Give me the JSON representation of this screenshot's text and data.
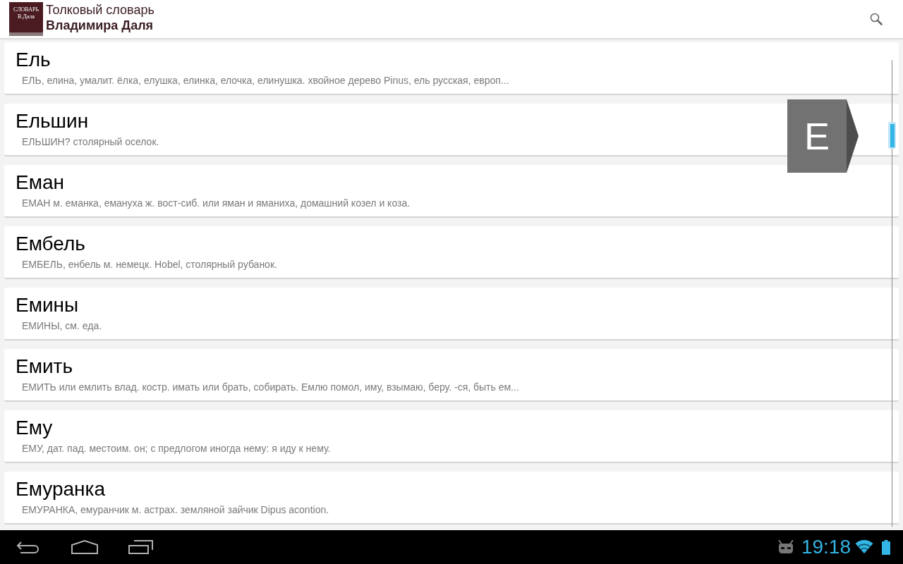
{
  "action_bar": {
    "logo": {
      "line_1": "СЛОВАРЬ",
      "line_2": "В.Даля"
    },
    "title": "Толковый словарь",
    "subtitle": "Владимира Даля"
  },
  "entries": [
    {
      "word": "Ель",
      "definition": "ЕЛЬ, елина, умалит. ёлка, елушка, елинка, елочка, елинушка. хвойное дерево Pinus, ель русская, европ..."
    },
    {
      "word": "Ельшин",
      "definition": "ЕЛЬШИН? столярный оселок."
    },
    {
      "word": "Еман",
      "definition": "ЕМАН м. еманка, емануха ж. вост-сиб. или яман и яманиха, домашний козел и коза."
    },
    {
      "word": "Ембель",
      "definition": "ЕМБЕЛЬ, енбель м. немецк. Hobel, столярный рубанок."
    },
    {
      "word": "Емины",
      "definition": "ЕМИНЫ, см. еда."
    },
    {
      "word": "Емить",
      "definition": "ЕМИТЬ или емлить влад. костр. имать или брать, собирать. Емлю помол, иму, взымаю, беру. -ся, быть ем..."
    },
    {
      "word": "Ему",
      "definition": "ЕМУ, дат. пад. местоим. он; с предлогом иногда нему: я иду к нему."
    },
    {
      "word": "Емуранка",
      "definition": "ЕМУРАНКА, емуранчик м. астрах. земляной зайчик Dipus acontion."
    }
  ],
  "fast_scroll": {
    "letter": "Е"
  },
  "status_bar": {
    "time": "19:18"
  }
}
